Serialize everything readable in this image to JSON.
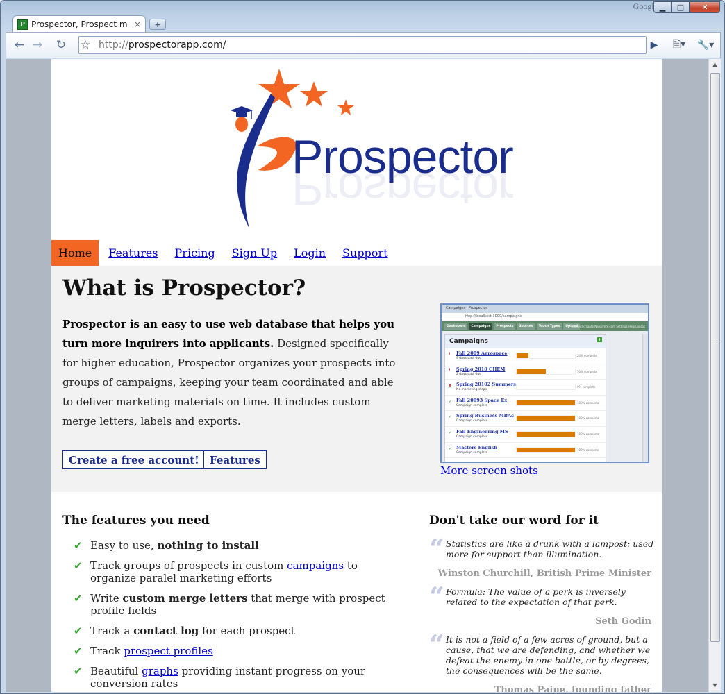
{
  "browser": {
    "google_label": "Google",
    "tab_title": "Prospector, Prospect ma...",
    "favicon_letter": "P",
    "new_tab": "+",
    "tab_close": "×",
    "url_scheme": "http://",
    "url_host": "prospectorapp.com/",
    "controls": {
      "minimize": "▁",
      "maximize": "□",
      "close": "✕"
    }
  },
  "logo": {
    "text": "Prospector"
  },
  "nav": {
    "home": "Home",
    "features": "Features",
    "pricing": "Pricing",
    "signup": "Sign Up",
    "login": "Login",
    "support": "Support"
  },
  "hero": {
    "title": "What is Prospector?",
    "intro_bold": "Prospector is an easy to use web database that helps you turn more inquirers into applicants.",
    "intro_rest": " Designed specifically for higher education, Prospector organizes your prospects into groups of campaigns, keeping your team coordinated and able to deliver marketing materials on time. It includes custom merge letters, labels and exports.",
    "cta_primary": "Create a free account!",
    "cta_secondary": "Features",
    "more_shots": "More screen shots"
  },
  "screenshot": {
    "tab_title": "Campaigns - Prospector",
    "url": "http://localhost:3000/campaigns",
    "tabs": [
      "Dashboard",
      "Campaigns",
      "Prospects",
      "Sources",
      "Touch Types",
      "Upload"
    ],
    "user_line": "Currently: Sante Navarrete.com Settings Help Logout",
    "heading": "Campaigns",
    "campaigns": [
      {
        "name": "Fall 2009 Aerospace",
        "sub": "9 days past due",
        "status": "!",
        "progress": 0.2,
        "pct": "20% complete"
      },
      {
        "name": "Spring 2010 CHEM",
        "sub": "2 days past due",
        "status": "!",
        "progress": 0.5,
        "pct": "50% complete"
      },
      {
        "name": "Spring 20102 Summers",
        "sub": "No marketing steps",
        "status": "x",
        "progress": 0,
        "pct": "0% complete"
      },
      {
        "name": "Fall 20093 Space Ex",
        "sub": "Campaign complete",
        "status": "✓",
        "progress": 1,
        "pct": "100% complete"
      },
      {
        "name": "Spring Business MBAs",
        "sub": "Campaign complete",
        "status": "✓",
        "progress": 1,
        "pct": "100% complete"
      },
      {
        "name": "Fall Engineering MS",
        "sub": "Campaign complete",
        "status": "✓",
        "progress": 1,
        "pct": "100% complete"
      },
      {
        "name": "Masters English",
        "sub": "Campaign complete",
        "status": "✓",
        "progress": 1,
        "pct": "100% complete"
      }
    ]
  },
  "features": {
    "heading": "The features you need",
    "items": [
      {
        "pre": "Easy to use, ",
        "bold": "nothing to install",
        "link": "",
        "post": ""
      },
      {
        "pre": "Track groups of prospects in custom ",
        "bold": "",
        "link": "campaigns",
        "post": " to organize paralel marketing efforts"
      },
      {
        "pre": "Write ",
        "bold": "custom merge letters",
        "link": "",
        "post": " that merge with prospect profile fields"
      },
      {
        "pre": "Track a ",
        "bold": "contact log",
        "link": "",
        "post": " for each prospect"
      },
      {
        "pre": "Track ",
        "bold": "",
        "link": "prospect profiles",
        "post": ""
      },
      {
        "pre": "Beautiful ",
        "bold": "",
        "link": "graphs",
        "post": " providing instant progress on your conversion rates"
      }
    ]
  },
  "quotes": {
    "heading": "Don't take our word for it",
    "items": [
      {
        "text": "Statistics are like a drunk with a lampost: used more for support than illumination.",
        "author": "Winston Churchill, British Prime Minister"
      },
      {
        "text": "Formula: The value of a perk is inversely related to the expectation of that perk.",
        "author": "Seth Godin"
      },
      {
        "text": "It is not a field of a few acres of ground, but a cause, that we are defending, and whether we defeat the enemy in one battle, or by degrees, the consequences will be the same.",
        "author": "Thomas Paine, founding father"
      }
    ]
  },
  "colors": {
    "brand_blue": "#1a2c8c",
    "brand_orange": "#f26522",
    "link": "#0000cc",
    "check_green": "#3aa335"
  }
}
